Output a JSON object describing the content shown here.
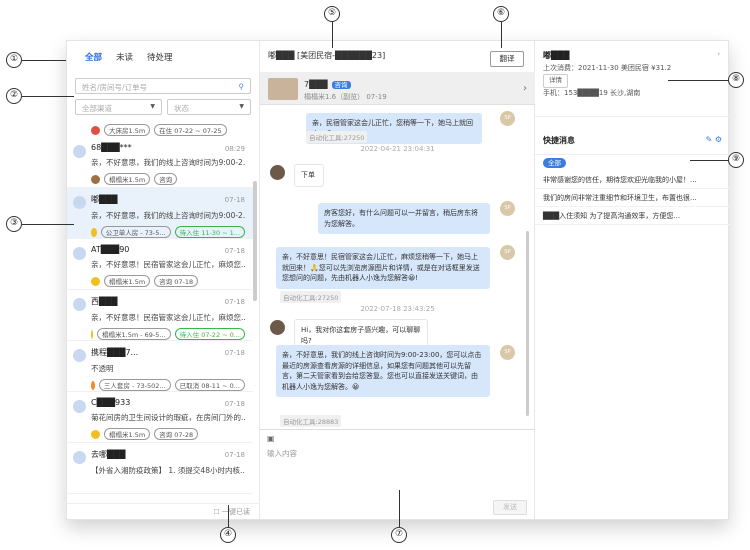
{
  "callouts": [
    "①",
    "②",
    "③",
    "④",
    "⑤",
    "⑥",
    "⑦",
    "⑧",
    "⑨"
  ],
  "left": {
    "tabs": [
      {
        "label": "全部",
        "active": true
      },
      {
        "label": "未读"
      },
      {
        "label": "待处理"
      }
    ],
    "search_placeholder": "姓名/房间号/订单号",
    "filter_channel": "全部渠道",
    "filter_status": "状态",
    "first_row": {
      "room": "大床房1.5m",
      "date": "在住 07-22 ~ 07-25"
    },
    "conversations": [
      {
        "name": "68███***",
        "time": "08:29",
        "msg": "亲，不好意思，我们的线上咨询时间为9:00-2...",
        "tags": [
          {
            "t": "榻榻米1.5m"
          },
          {
            "t": "咨询"
          }
        ],
        "dot": "brown",
        "active": false
      },
      {
        "name": "嘟███",
        "time": "07-18",
        "msg": "亲，不好意思，我们的线上咨询时间为9:00-2...",
        "tags": [
          {
            "t": "公卫单人房 - 73-5..."
          },
          {
            "t": "待入住 11-30 ~ 1...",
            "green": true
          }
        ],
        "dot": "yellow",
        "active": true
      },
      {
        "name": "AT███90",
        "time": "07-18",
        "msg": "亲，不好意思！民宿管家这会儿正忙，麻烦您...",
        "tags": [
          {
            "t": "榻榻米1.5m"
          },
          {
            "t": "咨询 07-18"
          }
        ],
        "dot": "yellow",
        "active": false
      },
      {
        "name": "西███",
        "time": "07-18",
        "msg": "亲，不好意思！民宿管家这会儿正忙，麻烦您...",
        "tags": [
          {
            "t": "榻榻米1.5m - 69-5..."
          },
          {
            "t": "待入住 07-22 ~ 0...",
            "green": true
          }
        ],
        "dot": "yellow",
        "active": false
      },
      {
        "name": "携程███7...",
        "time": "07-18",
        "msg": "不透明",
        "tags": [
          {
            "t": "三人套房 - 73-502..."
          },
          {
            "t": "已取消 08-11 ~ 0..."
          }
        ],
        "dot": "orange",
        "active": false
      },
      {
        "name": "C███933",
        "time": "07-18",
        "msg": "菊花间房的卫生间设计的瑕疵，在房间门外的...",
        "tags": [
          {
            "t": "榻榻米1.5m"
          },
          {
            "t": "咨询 07-28"
          }
        ],
        "dot": "yellow",
        "active": false
      },
      {
        "name": "去哪███",
        "time": "07-18",
        "msg": "【外省入湘防疫政策】 1. 须提交48小时内核...",
        "tags": [],
        "dot": "yellow",
        "active": false
      }
    ],
    "footer": "一键已读"
  },
  "chat": {
    "title": "嘟███ [美团民宿-██████23]",
    "translate": "翻译",
    "house_title": "7███",
    "house_badge": "咨询",
    "house_sub": "榻榻米1.6（副览）  07-19",
    "messages": [
      {
        "text": "亲，民宿管家这会儿正忙，您稍等一下，她马上就回来...😀",
        "auto": "自动化工具:27250"
      },
      {
        "stamp": "2022-04-21 23:04:31"
      },
      {
        "text": "下单",
        "customer": true
      },
      {
        "text": "房客您好，有什么问题可以一并留言，稍后房东将为您解答。"
      },
      {
        "text": "亲，不好意思！民宿管家这会儿正忙，麻烦您稍等一下，她马上就回来！🙏您可以先浏览房源图片和详情，或是在对话框里发送您想问的问题，先由机器人小逸为您解答😀!",
        "auto": "自动化工具:27250"
      },
      {
        "stamp": "2022-07-18 23:43:25"
      },
      {
        "text": "Hi，我对你这套房子感兴趣，可以聊聊吗?",
        "customer": true
      },
      {
        "text": "亲，不好意思，我们的线上咨询时间为9:00-23:00，您可以点击最近的房源查看房源的详细信息，如果您有问题其他可以先留言，第二天管家看到会给您答复。您也可以直接发送关键词，由机器人小逸为您解答。😀",
        "auto": "自动化工具:28883"
      }
    ],
    "input_placeholder": "输入内容",
    "send": "发送"
  },
  "profile": {
    "name": "嘟███",
    "last": "上次消费：2021-11-30 美团民宿 ¥31.2",
    "detail": "详情",
    "phone": "手机：153████19  长沙,湖南"
  },
  "quick": {
    "title": "快捷消息",
    "all": "全部",
    "items": [
      "非常感谢您的信任，期待您欢迎光临我的小屋！...",
      "我们的房间非常注重细节和环境卫生，布置也很...",
      "███入住须知 为了提高沟通效率，方便您..."
    ]
  }
}
